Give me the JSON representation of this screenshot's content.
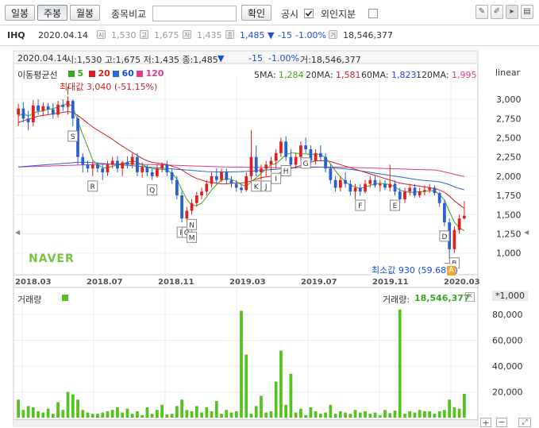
{
  "toolbar": {
    "period_buttons": [
      "일봉",
      "주봉",
      "월봉"
    ],
    "active_period": "주봉",
    "compare_label": "종목비교",
    "compare_value": "",
    "confirm_label": "확인",
    "disclosure_label": "공시",
    "foreign_label": "외인지분"
  },
  "ticker": {
    "symbol": "IHQ",
    "date": "2020.04.14",
    "open_icon": "시",
    "open": "1,530",
    "high_icon": "고",
    "high": "1,675",
    "low_icon": "저",
    "low": "1,435",
    "close_icon": "종",
    "close": "1,485",
    "change_arrow": "▼",
    "change": "-15",
    "change_pct": "-1.00%",
    "volume_icon": "거",
    "volume": "18,546,377"
  },
  "price_panel": {
    "info_date": "2020.04.14",
    "info_ohlc": "시:1,530 고:1,675 저:1,435 종:1,485",
    "info_arrow": "▼",
    "info_change": "-15",
    "info_pct": "-1.00%",
    "info_vol": "거:18,546,377",
    "ma_legend_title": "이동평균선",
    "ma_periods": [
      "5",
      "20",
      "60",
      "120"
    ],
    "ma_values": [
      {
        "label": "5MA:",
        "value": "1,284"
      },
      {
        "label": "20MA:",
        "value": "1,581"
      },
      {
        "label": "60MA:",
        "value": "1,823"
      },
      {
        "label": "120MA:",
        "value": "1,995"
      }
    ],
    "scale_label": "linear",
    "max_label": "최대값 3,040 (-51.15%)",
    "min_label": "최소값 930 (59.68%)",
    "watermark": "NAVER",
    "a_marker": "A",
    "collapse_left": "◀",
    "collapse_right": "◀"
  },
  "volume_panel": {
    "title": "거래량",
    "legend": "거래량:",
    "legend_value": "18,546,377",
    "unit": "*1,000",
    "close": "×"
  },
  "footer": {
    "plus": "+",
    "minus": "−"
  },
  "colors": {
    "up": "#e02020",
    "down": "#2a5fd0",
    "ma5": "#3aa81e",
    "ma20": "#d32020",
    "ma60": "#2a67d8",
    "ma120": "#e0398f",
    "volume": "#55c21f"
  },
  "chart_data": {
    "type": "candlestick",
    "price_axis": {
      "ticks": [
        1000,
        1250,
        1500,
        1750,
        2000,
        2250,
        2500,
        2750,
        3000
      ],
      "tick_labels": [
        "1,000",
        "1,250",
        "1,500",
        "1,750",
        "2,000",
        "2,250",
        "2,500",
        "2,750",
        "3,000"
      ],
      "range": [
        780,
        3300
      ]
    },
    "x_axis_labels": [
      "2018.03",
      "2018.07",
      "2018.11",
      "2019.03",
      "2019.07",
      "2019.11",
      "2020.03"
    ],
    "volume_axis": {
      "ticks": [
        20000,
        40000,
        60000,
        80000
      ],
      "tick_labels": [
        "20,000",
        "40,000",
        "60,000",
        "80,000"
      ],
      "range": [
        0,
        90000
      ]
    },
    "candles": [
      [
        2800,
        2940,
        2650,
        2880
      ],
      [
        2880,
        2960,
        2700,
        2750
      ],
      [
        2750,
        2850,
        2600,
        2700
      ],
      [
        2700,
        2990,
        2650,
        2920
      ],
      [
        2920,
        3000,
        2800,
        2850
      ],
      [
        2850,
        2960,
        2780,
        2910
      ],
      [
        2910,
        2950,
        2800,
        2870
      ],
      [
        2870,
        2950,
        2750,
        2800
      ],
      [
        2800,
        2980,
        2760,
        2930
      ],
      [
        2930,
        3000,
        2850,
        2900
      ],
      [
        2900,
        3040,
        2800,
        2980
      ],
      [
        2980,
        3000,
        2650,
        2750
      ],
      [
        2750,
        2800,
        2150,
        2250
      ],
      [
        2250,
        2300,
        2050,
        2150
      ],
      [
        2150,
        2200,
        2050,
        2100
      ],
      [
        2100,
        2200,
        2000,
        2150
      ],
      [
        2150,
        2180,
        2050,
        2100
      ],
      [
        2100,
        2150,
        1950,
        2050
      ],
      [
        2050,
        2200,
        2000,
        2150
      ],
      [
        2150,
        2250,
        2100,
        2200
      ],
      [
        2200,
        2260,
        2050,
        2100
      ],
      [
        2100,
        2200,
        2000,
        2180
      ],
      [
        2180,
        2260,
        2100,
        2150
      ],
      [
        2150,
        2300,
        2100,
        2250
      ],
      [
        2250,
        2300,
        2000,
        2050
      ],
      [
        2050,
        2180,
        1980,
        2120
      ],
      [
        2120,
        2150,
        2000,
        2050
      ],
      [
        2050,
        2100,
        1950,
        2000
      ],
      [
        2000,
        2150,
        1980,
        2100
      ],
      [
        2100,
        2180,
        2050,
        2150
      ],
      [
        2150,
        2200,
        2000,
        2050
      ],
      [
        2050,
        2100,
        1900,
        1950
      ],
      [
        1950,
        2000,
        1700,
        1750
      ],
      [
        1750,
        1800,
        1400,
        1450
      ],
      [
        1450,
        1600,
        1400,
        1550
      ],
      [
        1550,
        1700,
        1500,
        1650
      ],
      [
        1650,
        1800,
        1600,
        1750
      ],
      [
        1750,
        1850,
        1700,
        1800
      ],
      [
        1800,
        1950,
        1750,
        1900
      ],
      [
        1900,
        2050,
        1850,
        2000
      ],
      [
        2000,
        2100,
        1900,
        1950
      ],
      [
        1950,
        2100,
        1920,
        2050
      ],
      [
        2050,
        2100,
        1900,
        1950
      ],
      [
        1950,
        2000,
        1850,
        1900
      ],
      [
        1900,
        1950,
        1800,
        1850
      ],
      [
        1850,
        1900,
        1780,
        1820
      ],
      [
        1820,
        2050,
        1800,
        2000
      ],
      [
        2000,
        2600,
        1950,
        2250
      ],
      [
        2250,
        2400,
        2000,
        2050
      ],
      [
        2050,
        2150,
        1950,
        2100
      ],
      [
        2100,
        2200,
        2000,
        2150
      ],
      [
        2150,
        2250,
        2050,
        2200
      ],
      [
        2200,
        2350,
        2100,
        2300
      ],
      [
        2300,
        2500,
        2250,
        2450
      ],
      [
        2450,
        2520,
        2200,
        2250
      ],
      [
        2250,
        2350,
        2100,
        2150
      ],
      [
        2150,
        2300,
        2100,
        2250
      ],
      [
        2250,
        2450,
        2200,
        2400
      ],
      [
        2400,
        2500,
        2300,
        2350
      ],
      [
        2350,
        2400,
        2150,
        2200
      ],
      [
        2200,
        2350,
        2150,
        2300
      ],
      [
        2300,
        2400,
        2200,
        2250
      ],
      [
        2250,
        2300,
        2050,
        2100
      ],
      [
        2100,
        2150,
        1900,
        1950
      ],
      [
        1950,
        2000,
        1800,
        1850
      ],
      [
        1850,
        2000,
        1800,
        1950
      ],
      [
        1950,
        2050,
        1850,
        1900
      ],
      [
        1900,
        1950,
        1750,
        1800
      ],
      [
        1800,
        1900,
        1700,
        1850
      ],
      [
        1850,
        1900,
        1750,
        1800
      ],
      [
        1800,
        1950,
        1780,
        1900
      ],
      [
        1900,
        2000,
        1850,
        1950
      ],
      [
        1950,
        2000,
        1850,
        1880
      ],
      [
        1880,
        1950,
        1800,
        1900
      ],
      [
        1900,
        1950,
        1820,
        1850
      ],
      [
        1850,
        2150,
        1800,
        1900
      ],
      [
        1900,
        1950,
        1750,
        1800
      ],
      [
        1800,
        1850,
        1650,
        1700
      ],
      [
        1700,
        1850,
        1650,
        1800
      ],
      [
        1800,
        1900,
        1750,
        1850
      ],
      [
        1850,
        1900,
        1720,
        1750
      ],
      [
        1750,
        1850,
        1720,
        1800
      ],
      [
        1800,
        1880,
        1750,
        1820
      ],
      [
        1820,
        1900,
        1780,
        1850
      ],
      [
        1850,
        1880,
        1750,
        1780
      ],
      [
        1780,
        1800,
        1600,
        1650
      ],
      [
        1650,
        1700,
        1350,
        1400
      ],
      [
        1400,
        1450,
        930,
        1050
      ],
      [
        1050,
        1350,
        1000,
        1300
      ],
      [
        1300,
        1500,
        1250,
        1450
      ],
      [
        1450,
        1675,
        1435,
        1485
      ]
    ],
    "ma5": [
      2780,
      2820,
      2780,
      2820,
      2840,
      2850,
      2870,
      2880,
      2900,
      2920,
      2950,
      2900,
      2720,
      2540,
      2380,
      2210,
      2150,
      2110,
      2110,
      2130,
      2140,
      2160,
      2180,
      2200,
      2180,
      2150,
      2120,
      2100,
      2090,
      2090,
      2080,
      2040,
      1960,
      1820,
      1700,
      1620,
      1620,
      1650,
      1730,
      1820,
      1890,
      1950,
      1970,
      1960,
      1930,
      1890,
      1870,
      1930,
      1980,
      2040,
      2090,
      2150,
      2160,
      2220,
      2280,
      2300,
      2300,
      2290,
      2290,
      2280,
      2290,
      2280,
      2240,
      2160,
      2070,
      1990,
      1930,
      1880,
      1860,
      1840,
      1860,
      1880,
      1900,
      1910,
      1900,
      1890,
      1860,
      1820,
      1800,
      1790,
      1790,
      1800,
      1800,
      1810,
      1810,
      1760,
      1690,
      1540,
      1400,
      1330,
      1290
    ],
    "ma20": [
      2700,
      2720,
      2740,
      2760,
      2780,
      2790,
      2800,
      2810,
      2820,
      2830,
      2840,
      2830,
      2790,
      2740,
      2690,
      2640,
      2600,
      2560,
      2520,
      2480,
      2430,
      2390,
      2350,
      2310,
      2270,
      2230,
      2200,
      2180,
      2170,
      2160,
      2150,
      2130,
      2110,
      2080,
      2040,
      2000,
      1970,
      1950,
      1930,
      1920,
      1910,
      1900,
      1900,
      1910,
      1910,
      1910,
      1920,
      1940,
      1960,
      1980,
      1990,
      2000,
      2020,
      2050,
      2080,
      2100,
      2120,
      2140,
      2160,
      2180,
      2200,
      2200,
      2200,
      2190,
      2170,
      2150,
      2130,
      2110,
      2090,
      2070,
      2050,
      2030,
      2010,
      1990,
      1970,
      1950,
      1930,
      1910,
      1900,
      1890,
      1880,
      1870,
      1860,
      1850,
      1840,
      1820,
      1790,
      1740,
      1680,
      1630,
      1581
    ],
    "ma60": [
      2120,
      2125,
      2130,
      2135,
      2140,
      2145,
      2150,
      2155,
      2160,
      2165,
      2170,
      2175,
      2180,
      2180,
      2180,
      2175,
      2170,
      2165,
      2160,
      2155,
      2150,
      2145,
      2140,
      2135,
      2130,
      2125,
      2120,
      2115,
      2110,
      2105,
      2100,
      2095,
      2090,
      2085,
      2080,
      2075,
      2070,
      2065,
      2060,
      2058,
      2056,
      2055,
      2055,
      2056,
      2058,
      2060,
      2063,
      2066,
      2070,
      2075,
      2080,
      2085,
      2090,
      2095,
      2100,
      2105,
      2110,
      2115,
      2118,
      2120,
      2120,
      2118,
      2115,
      2110,
      2105,
      2100,
      2095,
      2090,
      2080,
      2070,
      2060,
      2050,
      2040,
      2030,
      2020,
      2010,
      2000,
      1990,
      1980,
      1970,
      1960,
      1950,
      1945,
      1940,
      1935,
      1925,
      1910,
      1890,
      1860,
      1840,
      1823
    ],
    "ma120": [
      2120,
      2122,
      2124,
      2126,
      2128,
      2130,
      2132,
      2134,
      2136,
      2138,
      2140,
      2142,
      2144,
      2146,
      2148,
      2150,
      2152,
      2154,
      2156,
      2158,
      2160,
      2160,
      2160,
      2158,
      2156,
      2154,
      2152,
      2150,
      2148,
      2146,
      2144,
      2142,
      2140,
      2138,
      2136,
      2134,
      2132,
      2130,
      2128,
      2126,
      2124,
      2122,
      2120,
      2119,
      2118,
      2117,
      2116,
      2115,
      2114,
      2113,
      2112,
      2111,
      2110,
      2110,
      2110,
      2111,
      2112,
      2113,
      2114,
      2115,
      2116,
      2117,
      2118,
      2118,
      2118,
      2117,
      2116,
      2114,
      2112,
      2110,
      2108,
      2106,
      2104,
      2102,
      2100,
      2098,
      2096,
      2094,
      2092,
      2090,
      2088,
      2086,
      2084,
      2082,
      2080,
      2070,
      2055,
      2040,
      2025,
      2010,
      1995
    ],
    "volume": [
      14000,
      6000,
      9000,
      8000,
      5000,
      4000,
      7000,
      3000,
      12000,
      6000,
      20000,
      18000,
      14000,
      6000,
      4000,
      3000,
      3000,
      4000,
      5000,
      6000,
      8000,
      4000,
      7000,
      3000,
      5000,
      2000,
      8000,
      3000,
      6000,
      10000,
      2500,
      3000,
      9000,
      14000,
      6000,
      5000,
      9000,
      4000,
      8000,
      5000,
      13000,
      3000,
      6000,
      4000,
      5000,
      8000,
      2500,
      3000,
      9000,
      17000,
      4000,
      5000,
      8000,
      3000,
      10000,
      2500,
      4000,
      7000,
      2000,
      8000,
      5000,
      3000,
      4000,
      10000,
      3000,
      5000,
      4000,
      3000,
      6000,
      4000,
      5000,
      3000,
      4000,
      2000,
      6000,
      3500,
      5500,
      3000,
      3000,
      5000,
      4000,
      6000,
      5000,
      5000,
      3000,
      5000,
      6000,
      14000,
      8000,
      7000,
      18546
    ],
    "volume_spikes": {
      "45": 83000,
      "46": 49000,
      "52": 28000,
      "53": 52000,
      "55": 34000,
      "77": 84000
    },
    "point_labels": [
      {
        "i": 11,
        "text": "S"
      },
      {
        "i": 15,
        "text": "R"
      },
      {
        "i": 27,
        "text": "Q"
      },
      {
        "i": 33,
        "text": "P"
      },
      {
        "i": 34,
        "text": "O"
      },
      {
        "i": 35,
        "text": "N"
      },
      {
        "i": 35,
        "text": "M"
      },
      {
        "i": 48,
        "text": "K"
      },
      {
        "i": 50,
        "text": "J"
      },
      {
        "i": 52,
        "text": "I"
      },
      {
        "i": 54,
        "text": "H"
      },
      {
        "i": 58,
        "text": "G"
      },
      {
        "i": 69,
        "text": "F"
      },
      {
        "i": 76,
        "text": "E"
      },
      {
        "i": 86,
        "text": "D"
      },
      {
        "i": 87,
        "text": "C"
      },
      {
        "i": 88,
        "text": "B"
      }
    ]
  }
}
